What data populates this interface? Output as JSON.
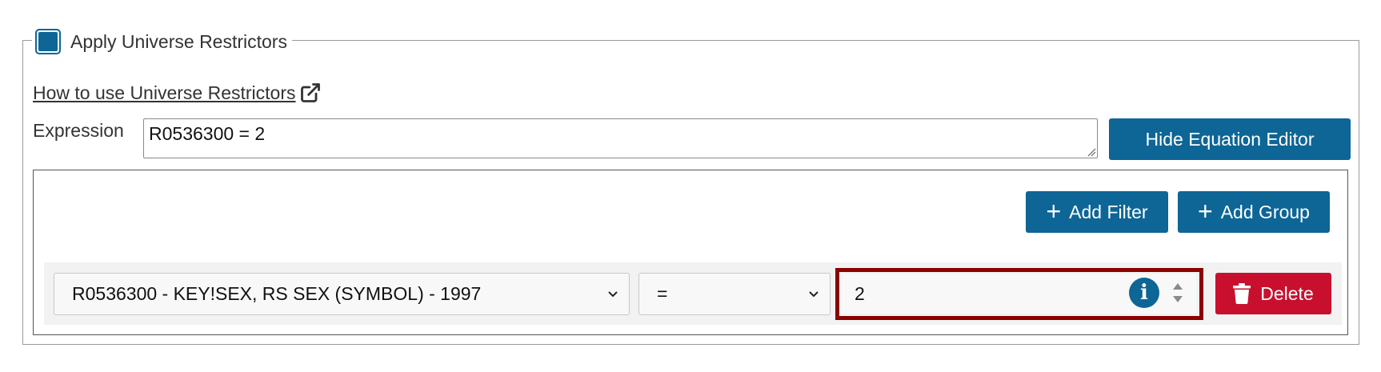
{
  "fieldset": {
    "legend": "Apply Universe Restrictors",
    "checkbox_checked": true
  },
  "help_link": {
    "label": "How to use Universe Restrictors"
  },
  "expression": {
    "label": "Expression",
    "value": "R0536300 = 2"
  },
  "toolbar": {
    "hide_editor_label": "Hide Equation Editor",
    "add_filter_label": "Add Filter",
    "add_group_label": "Add Group"
  },
  "rule": {
    "field": "R0536300 - KEY!SEX, RS SEX (SYMBOL) - 1997",
    "operator": "=",
    "value": "2",
    "delete_label": "Delete"
  },
  "colors": {
    "accent": "#0d6696",
    "danger": "#c8102e",
    "highlight": "#8b0000"
  },
  "icons": [
    "checkbox-icon",
    "external-link-icon",
    "plus-icon",
    "chevron-down-icon",
    "info-icon",
    "spinner-icon",
    "trash-icon"
  ]
}
